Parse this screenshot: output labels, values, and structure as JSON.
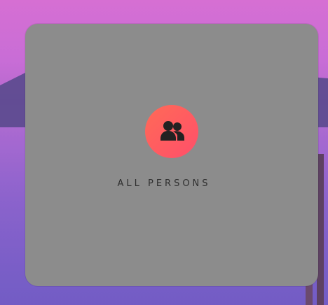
{
  "card": {
    "label": "ALL PERSONS",
    "icon": "people-icon"
  },
  "colors": {
    "card_background": "#8c8c8c",
    "icon_gradient_start": "#ff6a57",
    "icon_gradient_end": "#ff4f6a",
    "label_text": "#2f2f2f"
  }
}
